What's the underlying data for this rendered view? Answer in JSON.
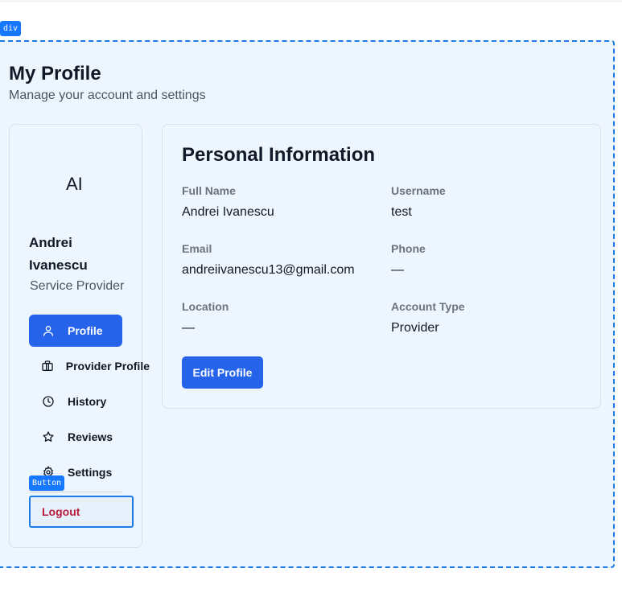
{
  "debug": {
    "container_tag": "div",
    "button_tag": "Button"
  },
  "header": {
    "title": "My Profile",
    "subtitle": "Manage your account and settings"
  },
  "sidebar": {
    "initials": "AI",
    "name": "Andrei Ivanescu",
    "role": "Service Provider",
    "items": [
      {
        "label": "Profile",
        "icon": "user-icon",
        "active": true
      },
      {
        "label": "Provider Profile",
        "icon": "briefcase-icon",
        "active": false
      },
      {
        "label": "History",
        "icon": "clock-icon",
        "active": false
      },
      {
        "label": "Reviews",
        "icon": "star-icon",
        "active": false
      },
      {
        "label": "Settings",
        "icon": "gear-icon",
        "active": false
      }
    ],
    "logout_label": "Logout"
  },
  "personal_info": {
    "title": "Personal Information",
    "fields": [
      {
        "label": "Full Name",
        "value": "Andrei Ivanescu"
      },
      {
        "label": "Username",
        "value": "test"
      },
      {
        "label": "Email",
        "value": "andreiivanescu13@gmail.com"
      },
      {
        "label": "Phone",
        "value": "—"
      },
      {
        "label": "Location",
        "value": "—"
      },
      {
        "label": "Account Type",
        "value": "Provider"
      }
    ],
    "edit_label": "Edit Profile"
  },
  "colors": {
    "accent": "#2563eb",
    "background": "#eef6fd",
    "logout_text": "#b91c3c",
    "debug_outline": "#1b7ae6"
  }
}
